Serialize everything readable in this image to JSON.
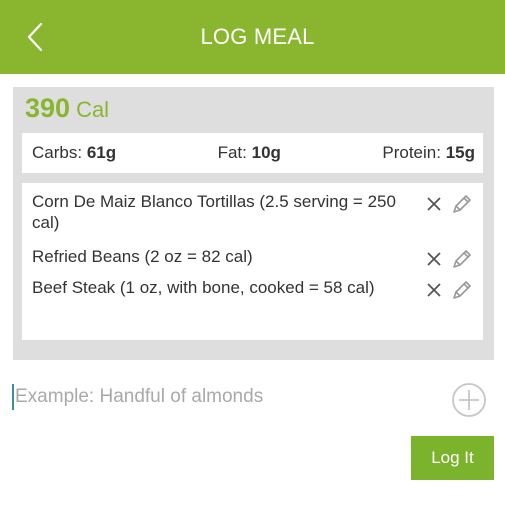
{
  "header": {
    "title": "LOG MEAL"
  },
  "summary": {
    "calories_value": "390",
    "calories_unit": "Cal",
    "macros": [
      {
        "label": "Carbs:",
        "value": "61g"
      },
      {
        "label": "Fat:",
        "value": "10g"
      },
      {
        "label": "Protein:",
        "value": "15g"
      }
    ],
    "items": [
      {
        "text": "Corn De Maiz Blanco Tortillas (2.5 serving = 250 cal)"
      },
      {
        "text": "Refried Beans (2 oz = 82 cal)"
      },
      {
        "text": "Beef Steak (1 oz, with bone, cooked  = 58 cal)"
      }
    ]
  },
  "input": {
    "placeholder": "Example: Handful of almonds",
    "value": ""
  },
  "log_button": {
    "label": "Log It"
  },
  "colors": {
    "brand_green": "#8ab52f",
    "button_green": "#7cb32d",
    "card_gray": "#dedede"
  },
  "icons": {
    "back": "chevron-left-icon",
    "remove": "close-icon",
    "edit": "pencil-icon",
    "add": "plus-circle-icon"
  }
}
